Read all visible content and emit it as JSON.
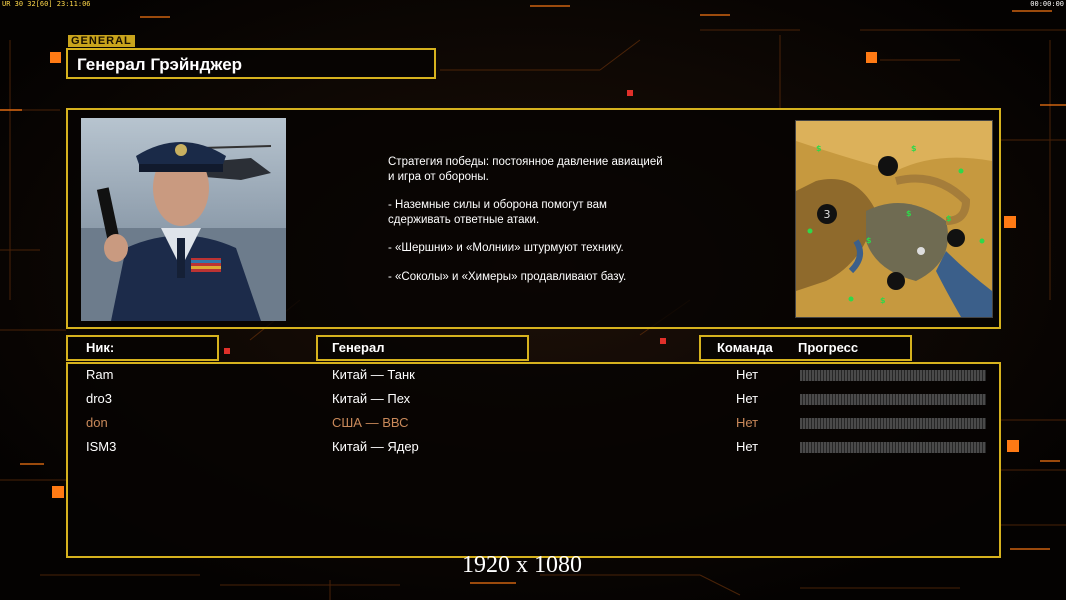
{
  "hud": {
    "left_stats": "UR 30 32[60] 23:11:06",
    "right_clock": "00:00:00"
  },
  "header": {
    "section_tag": "GENERAL",
    "title": "Генерал Грэйнджер"
  },
  "general": {
    "portrait_icon": "general-portrait",
    "description": [
      "Стратегия победы: постоянное давление авиацией\n и игра от обороны.",
      "- Наземные силы и оборона помогут вам\n  сдерживать ответные атаки.",
      "- «Шершни» и «Молнии» штурмуют технику.",
      "- «Соколы» и «Химеры» продавливают базу."
    ],
    "map": {
      "start_marker": "3",
      "supply_marker": "$"
    }
  },
  "columns": {
    "nick": "Ник:",
    "general": "Генерал",
    "team": "Команда",
    "progress": "Прогресс"
  },
  "players": [
    {
      "nick": "Ram",
      "general": "Китай — Танк",
      "team": "Нет",
      "progress": 0,
      "color": "#ffffff"
    },
    {
      "nick": "dro3",
      "general": "Китай — Пех",
      "team": "Нет",
      "progress": 0,
      "color": "#ffffff"
    },
    {
      "nick": "don",
      "general": "США — ВВС",
      "team": "Нет",
      "progress": 0,
      "color": "#c9895a"
    },
    {
      "nick": "ISM3",
      "general": "Китай — Ядер",
      "team": "Нет",
      "progress": 0,
      "color": "#ffffff"
    }
  ],
  "footer": {
    "resolution": "1920 x 1080"
  },
  "colors": {
    "accent": "#d6b21e",
    "highlight_orange": "#ff7a14"
  }
}
